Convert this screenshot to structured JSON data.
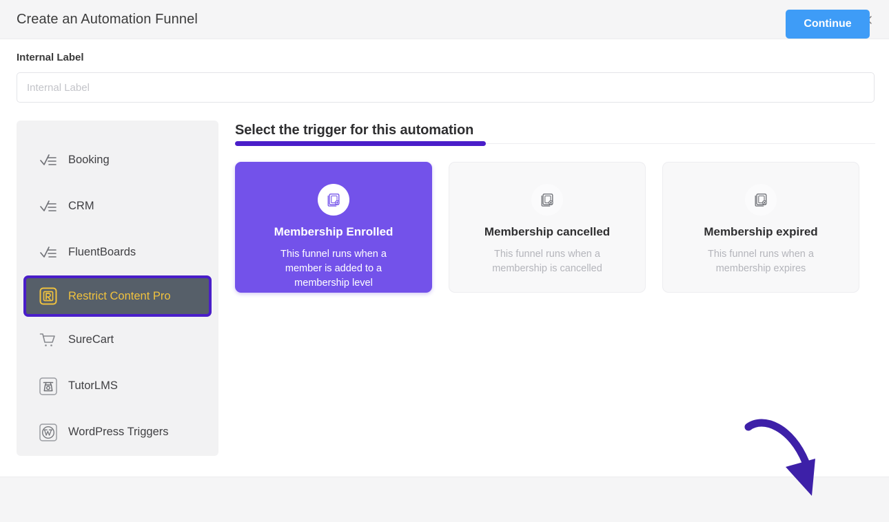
{
  "header": {
    "title": "Create an Automation Funnel",
    "close_icon": "close-icon"
  },
  "form": {
    "internal_label": {
      "label": "Internal Label",
      "placeholder": "Internal Label",
      "value": ""
    }
  },
  "sidebar": {
    "items": [
      {
        "label": "Booking",
        "icon": "checklist-icon",
        "selected": false
      },
      {
        "label": "CRM",
        "icon": "checklist-icon",
        "selected": false
      },
      {
        "label": "FluentBoards",
        "icon": "checklist-icon",
        "selected": false
      },
      {
        "label": "Restrict Content Pro",
        "icon": "restrict-content-pro-icon",
        "selected": true
      },
      {
        "label": "SureCart",
        "icon": "shopping-cart-icon",
        "selected": false
      },
      {
        "label": "TutorLMS",
        "icon": "tutorlms-icon",
        "selected": false
      },
      {
        "label": "WordPress Triggers",
        "icon": "wordpress-icon",
        "selected": false
      }
    ]
  },
  "main": {
    "heading": "Select the trigger for this automation",
    "triggers": [
      {
        "title": "Membership Enrolled",
        "description": "This funnel runs when a member is added to a membership level",
        "icon": "document-add-icon",
        "selected": true
      },
      {
        "title": "Membership cancelled",
        "description": "This funnel runs when a membership is cancelled",
        "icon": "document-cancel-icon",
        "selected": false
      },
      {
        "title": "Membership expired",
        "description": "This funnel runs when a membership expires",
        "icon": "document-cancel-icon",
        "selected": false
      }
    ]
  },
  "footer": {
    "continue_label": "Continue"
  },
  "annotation": {
    "arrow_icon": "curved-arrow-icon",
    "arrow_color": "#3d20a8"
  },
  "colors": {
    "accent_purple": "#4a1ec9",
    "card_purple": "#7352ea",
    "button_blue": "#3e9cf7",
    "selected_gold": "#f0c23e",
    "selected_slate": "#565f69"
  }
}
